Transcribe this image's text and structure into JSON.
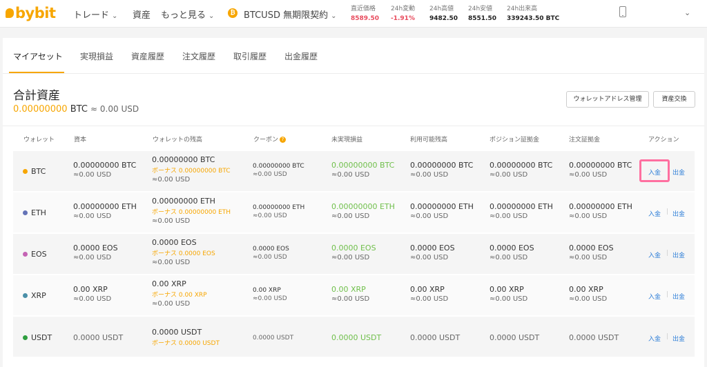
{
  "brand": {
    "name": "bybit",
    "color": "#f7a600"
  },
  "nav": {
    "trade": "トレード",
    "assets": "資産",
    "more": "もっと見る",
    "contract": "BTCUSD 無期限契約"
  },
  "ticker": [
    {
      "label": "直近価格",
      "value": "8589.50",
      "color": "#e84b5d"
    },
    {
      "label": "24h変動",
      "value": "-1.91%",
      "color": "#e84b5d"
    },
    {
      "label": "24h高値",
      "value": "9482.50",
      "color": "#222222"
    },
    {
      "label": "24h安値",
      "value": "8551.50",
      "color": "#222222"
    },
    {
      "label": "24h出来高",
      "value": "339243.50 BTC",
      "color": "#222222"
    }
  ],
  "tabs": [
    "マイアセット",
    "実現損益",
    "資産履歴",
    "注文履歴",
    "取引履歴",
    "出金履歴"
  ],
  "summary": {
    "title": "合計資産",
    "amount": "0.00000000",
    "unit": "BTC",
    "approx": "≈ 0.00 USD",
    "wallet_address_button": "ウォレットアドレス管理",
    "exchange_button": "資産交換"
  },
  "table": {
    "headers": [
      "ウォレット",
      "資本",
      "ウォレットの残高",
      "クーポン",
      "未実現損益",
      "利用可能残高",
      "ポジション証拠金",
      "注文証拠金",
      "アクション"
    ],
    "deposit_label": "入金",
    "withdraw_label": "出金",
    "rows": [
      {
        "coin": "BTC",
        "dot": "#f7a600",
        "capital": "0.00000000 BTC",
        "capital_usd": "≈0.00 USD",
        "balance": "0.00000000 BTC",
        "bonus": "ボーナス 0.00000000 BTC",
        "balance_usd": "≈0.00 USD",
        "coupon": "0.00000000 BTC",
        "coupon_usd": "≈0.00 USD",
        "unrealized": "0.00000000 BTC",
        "unrealized_usd": "≈0.00 USD",
        "available": "0.00000000 BTC",
        "available_usd": "≈0.00 USD",
        "position_margin": "0.00000000 BTC",
        "position_margin_usd": "≈0.00 USD",
        "order_margin": "0.00000000 BTC",
        "order_margin_usd": "≈0.00 USD"
      },
      {
        "coin": "ETH",
        "dot": "#6473b7",
        "capital": "0.00000000 ETH",
        "capital_usd": "≈0.00 USD",
        "balance": "0.00000000 ETH",
        "bonus": "ボーナス 0.00000000 ETH",
        "balance_usd": "≈0.00 USD",
        "coupon": "0.00000000 ETH",
        "coupon_usd": "≈0.00 USD",
        "unrealized": "0.00000000 ETH",
        "unrealized_usd": "≈0.00 USD",
        "available": "0.00000000 ETH",
        "available_usd": "≈0.00 USD",
        "position_margin": "0.00000000 ETH",
        "position_margin_usd": "≈0.00 USD",
        "order_margin": "0.00000000 ETH",
        "order_margin_usd": "≈0.00 USD"
      },
      {
        "coin": "EOS",
        "dot": "#c463b4",
        "capital": "0.0000 EOS",
        "capital_usd": "≈0.00 USD",
        "balance": "0.0000 EOS",
        "bonus": "ボーナス 0.0000 EOS",
        "balance_usd": "≈0.00 USD",
        "coupon": "0.0000 EOS",
        "coupon_usd": "≈0.00 USD",
        "unrealized": "0.0000 EOS",
        "unrealized_usd": "≈0.00 USD",
        "available": "0.0000 EOS",
        "available_usd": "≈0.00 USD",
        "position_margin": "0.0000 EOS",
        "position_margin_usd": "≈0.00 USD",
        "order_margin": "0.0000 EOS",
        "order_margin_usd": "≈0.00 USD"
      },
      {
        "coin": "XRP",
        "dot": "#4a8fa8",
        "capital": "0.00 XRP",
        "capital_usd": "≈0.00 USD",
        "balance": "0.00 XRP",
        "bonus": "ボーナス 0.00 XRP",
        "balance_usd": "≈0.00 USD",
        "coupon": "0.00 XRP",
        "coupon_usd": "≈0.00 USD",
        "unrealized": "0.00 XRP",
        "unrealized_usd": "≈0.00 USD",
        "available": "0.00 XRP",
        "available_usd": "≈0.00 USD",
        "position_margin": "0.00 XRP",
        "position_margin_usd": "≈0.00 USD",
        "order_margin": "0.00 XRP",
        "order_margin_usd": "≈0.00 USD"
      },
      {
        "coin": "USDT",
        "dot": "#2e9e3f",
        "capital": "0.0000 USDT",
        "balance": "0.0000 USDT",
        "bonus": "ボーナス 0.0000 USDT",
        "coupon": "0.0000 USDT",
        "unrealized": "0.0000 USDT",
        "available": "0.0000 USDT",
        "position_margin": "0.0000 USDT",
        "order_margin": "0.0000 USDT"
      }
    ]
  }
}
